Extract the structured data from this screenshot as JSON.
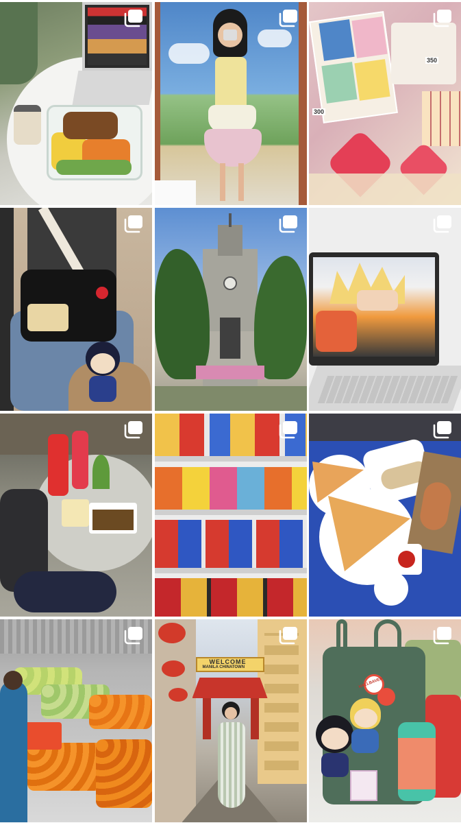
{
  "grid": {
    "posts": [
      {
        "id": 1,
        "icon": "carousel-icon",
        "colors": [
          "#7f8d6b",
          "#ffffff",
          "#2f3a2a"
        ]
      },
      {
        "id": 2,
        "icon": "carousel-icon",
        "colors": [
          "#6aa0d8",
          "#e9e3a0",
          "#e8c7d0"
        ]
      },
      {
        "id": 3,
        "icon": "carousel-icon",
        "colors": [
          "#d9a6b0",
          "#e94b5d",
          "#f1e6c8"
        ]
      },
      {
        "id": 4,
        "icon": "carousel-icon",
        "colors": [
          "#3a3a3a",
          "#111111",
          "#c7b39b"
        ]
      },
      {
        "id": 5,
        "icon": "carousel-icon",
        "colors": [
          "#6b8fc8",
          "#3e6b2e",
          "#a9a39a"
        ]
      },
      {
        "id": 6,
        "icon": "carousel-icon",
        "colors": [
          "#ececec",
          "#f09a3e",
          "#b9b9b9"
        ]
      },
      {
        "id": 7,
        "icon": "carousel-icon",
        "colors": [
          "#6d6d63",
          "#e03a3a",
          "#a8a8a0"
        ]
      },
      {
        "id": 8,
        "icon": "carousel-icon",
        "colors": [
          "#e8e8e8",
          "#d93a2f",
          "#f4c23b"
        ]
      },
      {
        "id": 9,
        "icon": "carousel-icon",
        "colors": [
          "#2c4fb0",
          "#ffffff",
          "#e3a552"
        ]
      },
      {
        "id": 10,
        "icon": "carousel-icon",
        "colors": [
          "#8a8a8a",
          "#f08a1e",
          "#b7d36a"
        ]
      },
      {
        "id": 11,
        "icon": "carousel-icon",
        "colors": [
          "#d6dbe4",
          "#d8342a",
          "#f1d07a"
        ]
      },
      {
        "id": 12,
        "icon": "carousel-icon",
        "colors": [
          "#e6e6e6",
          "#4d6b5a",
          "#e96a4b"
        ]
      }
    ],
    "signs": {
      "chinatown_welcome": "WELCOME",
      "chinatown_name": "MANILA CHINATOWN",
      "price_300": "300",
      "price_350": "350",
      "keychain_text": "HALLBAVEN"
    }
  }
}
